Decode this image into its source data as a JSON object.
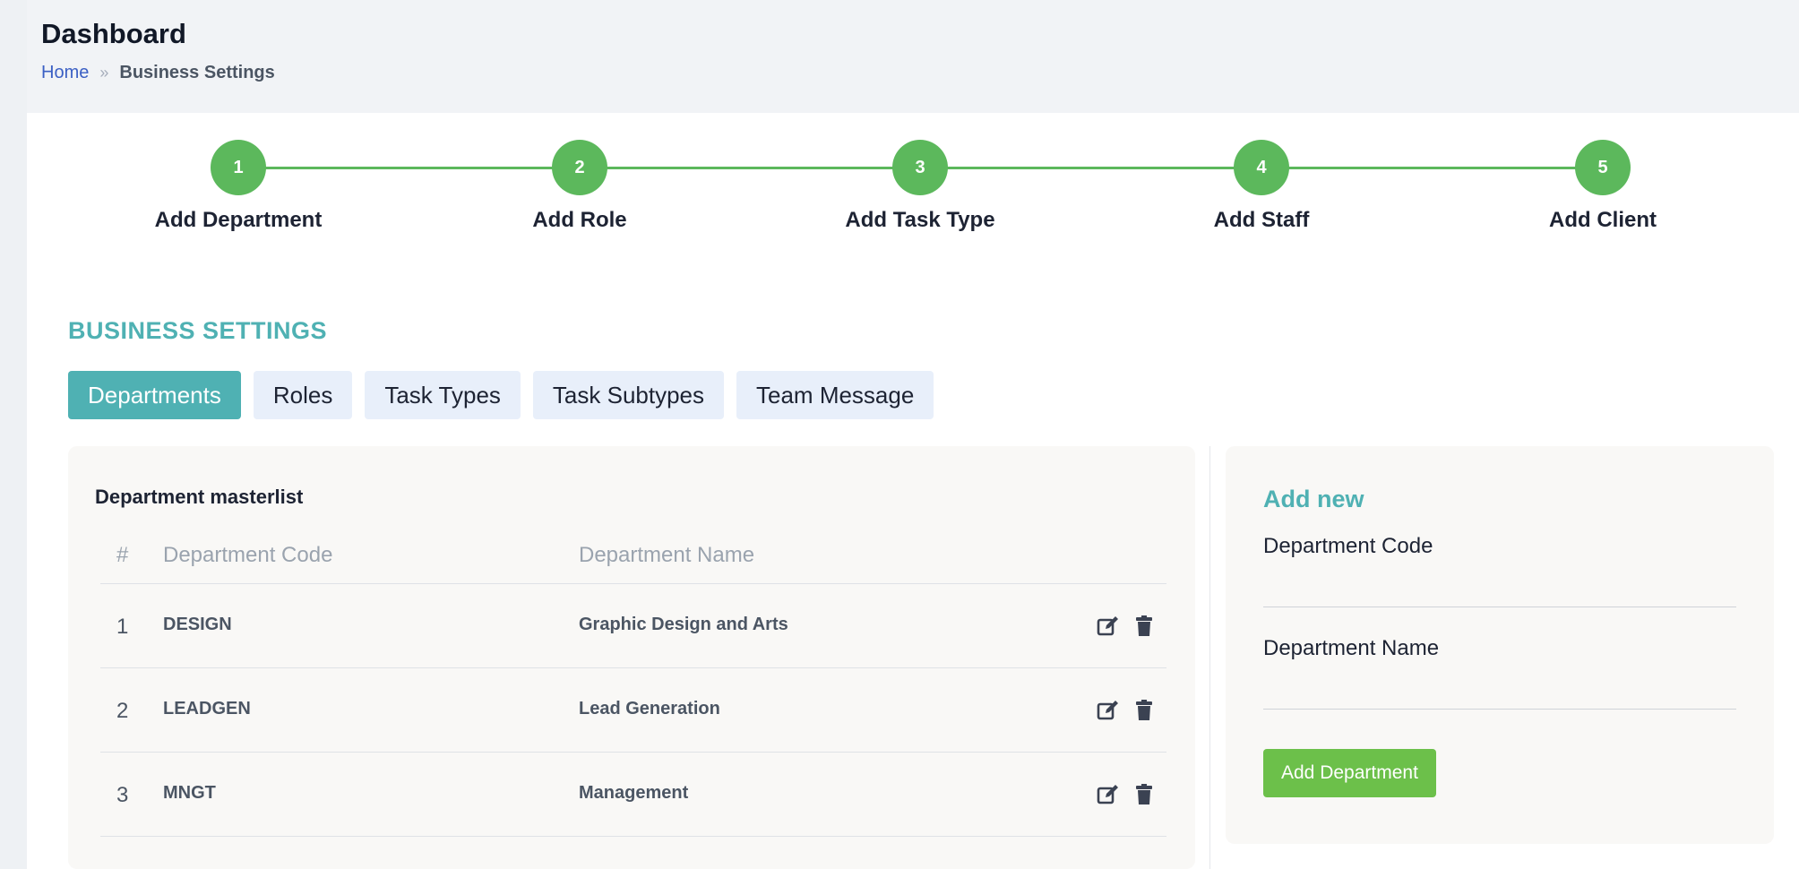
{
  "header": {
    "title": "Dashboard",
    "breadcrumb": {
      "home": "Home",
      "separator": "»",
      "current": "Business Settings"
    }
  },
  "stepper": {
    "steps": [
      {
        "number": "1",
        "label": "Add Department"
      },
      {
        "number": "2",
        "label": "Add Role"
      },
      {
        "number": "3",
        "label": "Add Task Type"
      },
      {
        "number": "4",
        "label": "Add Staff"
      },
      {
        "number": "5",
        "label": "Add Client"
      }
    ],
    "color": "#5cb85c"
  },
  "section": {
    "title": "BUSINESS SETTINGS"
  },
  "tabs": [
    {
      "label": "Departments",
      "active": true
    },
    {
      "label": "Roles",
      "active": false
    },
    {
      "label": "Task Types",
      "active": false
    },
    {
      "label": "Task Subtypes",
      "active": false
    },
    {
      "label": "Team Message",
      "active": false
    }
  ],
  "masterlist": {
    "title": "Department masterlist",
    "columns": {
      "num": "#",
      "code": "Department Code",
      "name": "Department Name"
    },
    "rows": [
      {
        "num": "1",
        "code": "DESIGN",
        "name": "Graphic Design and Arts"
      },
      {
        "num": "2",
        "code": "LEADGEN",
        "name": "Lead Generation"
      },
      {
        "num": "3",
        "code": "MNGT",
        "name": "Management"
      }
    ],
    "row_icons": [
      "edit-icon",
      "trash-icon"
    ]
  },
  "add_form": {
    "title": "Add new",
    "code_label": "Department Code",
    "code_value": "",
    "name_label": "Department Name",
    "name_value": "",
    "submit_label": "Add Department"
  },
  "colors": {
    "accent": "#4fb1b3",
    "success": "#6cc04a",
    "tab_bg": "#e8effa"
  }
}
